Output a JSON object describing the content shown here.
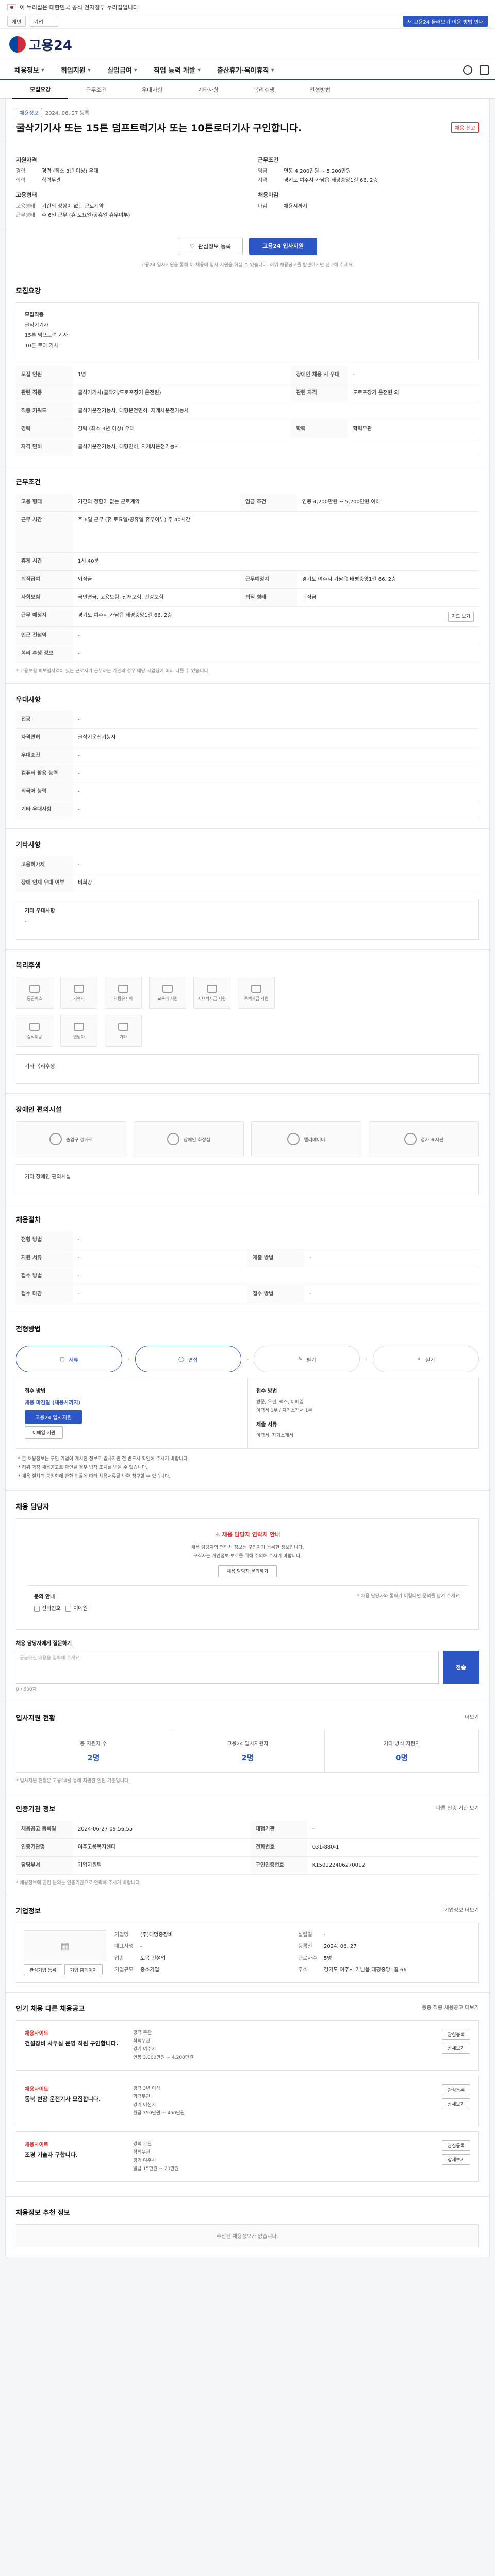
{
  "gov_bar": {
    "text": "이 누리집은 대한민국 공식 전자정부 누리집입니다."
  },
  "topline": {
    "tag_label": "개인",
    "select_value": "기업",
    "right_pill": "새 고용24 둘러보기 이용 방법 안내"
  },
  "header": {
    "logo_text": "고용24"
  },
  "nav": {
    "items": [
      {
        "label": "채용정보"
      },
      {
        "label": "취업지원"
      },
      {
        "label": "실업급여"
      },
      {
        "label": "직업 능력 개발"
      },
      {
        "label": "출산휴가·육아휴직"
      }
    ]
  },
  "subnav": {
    "tabs": [
      {
        "label": "모집요강"
      },
      {
        "label": "근무조건"
      },
      {
        "label": "우대사항"
      },
      {
        "label": "기타사항"
      },
      {
        "label": "복리후생"
      },
      {
        "label": "전형방법"
      }
    ]
  },
  "job": {
    "badge1": "채용정보",
    "badge_meta": "2024. 06. 27 등록",
    "title": "굴삭기기사 또는 15톤 덤프트럭기사 또는 10톤로더기사 구인합니다.",
    "report_label": "채용 신고",
    "summary_left_header": "지원자격",
    "summary_left": [
      {
        "k": "경력",
        "v": "경력 (최소 3년 이상) 우대"
      },
      {
        "k": "학력",
        "v": "학력무관"
      }
    ],
    "summary_right_header": "근무조건",
    "summary_right": [
      {
        "k": "임금",
        "v": "연봉 4,200만원 ~ 5,200만원"
      },
      {
        "k": "지역",
        "v": "경기도 여주시 가남읍 태평중앙1길 66, 2층"
      }
    ],
    "summary_left2_header": "고용형태",
    "summary_left2": [
      {
        "k": "고용형태",
        "v": "기간의 정함이 없는 근로계약"
      },
      {
        "k": "근무형태",
        "v": "주 6일 근무 (휴 토요일/공휴일 휴무여부)"
      }
    ],
    "summary_right2_header": "채용마감",
    "summary_right2": [
      {
        "k": "마감",
        "v": "채용시까지"
      }
    ],
    "btn_save": "관심정보 등록",
    "btn_apply": "고용24 입사지원",
    "note": "고용24 입사지원을 통해 이 채용에 입사 지원을 하실 수 있습니다. 허위 채용공고를 발견하시면 신고해 주세요."
  },
  "sec_recruit": {
    "title": "모집요강",
    "box_lines": [
      "모집직종",
      "굴삭기기사",
      "15톤 덤프트럭 기사",
      "10톤 로더 기사"
    ],
    "rows": [
      {
        "k": "모집 인원",
        "v": "1명",
        "k2": "장애인 채용 시 우대",
        "v2": "-"
      },
      {
        "k": "관련 직종",
        "v": "굴삭기기사(굴착기/도로포장기 운전원)",
        "k2": "관련 자격",
        "v2": "도로포장기 운전원 외"
      },
      {
        "k": "직종 키워드",
        "v": "굴삭기운전기능사, 대형운전면허, 지게차운전기능사"
      },
      {
        "k": "경력",
        "v": "경력 (최소 3년 이상) 우대",
        "k2": "학력",
        "v2": "학력무관"
      },
      {
        "k": "자격 면허",
        "v": "굴삭기운전기능사, 대형면허, 지게차운전기능사"
      }
    ]
  },
  "sec_work": {
    "title": "근무조건",
    "rows": [
      {
        "k": "고용 형태",
        "v": "기간의 정함이 없는 근로계약",
        "k2": "임금 조건",
        "v2": "연봉 4,200만원 ~ 5,200만원 이하"
      },
      {
        "k": "근무 시간",
        "v": "주 6일 근무 (휴 토요일/공휴일 휴무여부)  주 40시간"
      },
      {
        "k": "휴게 시간",
        "v": "1시 40분"
      },
      {
        "k": "퇴직급여",
        "v": "퇴직금",
        "k2": "근무예정지",
        "v2": "경기도 여주시 가남읍 태평중앙1길 66, 2층"
      },
      {
        "k": "사회보험",
        "v": "국민연금, 고용보험, 산재보험, 건강보험",
        "k2": "퇴직 형태",
        "v2": "퇴직금"
      },
      {
        "k": "근무 예정지",
        "v": "경기도 여주시 가남읍 태평중앙1길 66, 2층"
      },
      {
        "k": "인근 전철역",
        "v": "-"
      },
      {
        "k": "복리 후생 정보",
        "v": "-"
      }
    ],
    "map_btn": "지도 보기",
    "hint": "* 고용보험 피보험자격이 있는 근로자가 근무하는 기관의 경우 해당 사업장에 따라 다를 수 있습니다."
  },
  "sec_pref": {
    "title": "우대사항",
    "rows": [
      {
        "k": "전공",
        "v": "-"
      },
      {
        "k": "자격면허",
        "v": "굴삭기운전기능사"
      },
      {
        "k": "우대조건",
        "v": "-"
      },
      {
        "k": "컴퓨터 활용 능력",
        "v": "-"
      },
      {
        "k": "외국어 능력",
        "v": "-"
      },
      {
        "k": "기타 우대사항",
        "v": "-"
      }
    ]
  },
  "sec_etc": {
    "title": "기타사항",
    "rows": [
      {
        "k": "고용허가제",
        "v": "-"
      },
      {
        "k": "장애 인재 우대 여부",
        "v": "비희망"
      }
    ],
    "box_title": "기타 우대사항",
    "box_value": "-"
  },
  "sec_welfare": {
    "title": "복리후생",
    "tiles": [
      {
        "label": "통근버스"
      },
      {
        "label": "기숙사"
      },
      {
        "label": "차량유지비"
      },
      {
        "label": "교육비 지원"
      },
      {
        "label": "자녀학자금 지원"
      },
      {
        "label": "주택자금 지원"
      },
      {
        "label": "중식제공"
      },
      {
        "label": "연월차"
      },
      {
        "label": "기타"
      }
    ],
    "box_title": "기타 복리후생"
  },
  "sec_disabled": {
    "title": "장애인 편의시설",
    "tiles": [
      {
        "label": "출입구 경사로"
      },
      {
        "label": "장애인 화장실"
      },
      {
        "label": "엘리베이터"
      },
      {
        "label": "점자 표지판"
      }
    ],
    "box_title": "기타 장애인 편의시설"
  },
  "sec_hire": {
    "title": "채용절차",
    "rows": [
      {
        "k": "전형 방법",
        "v": "-"
      },
      {
        "k": "지원 서류",
        "v": "-",
        "k2": "제출 방법",
        "v2": "-"
      },
      {
        "k": "접수 방법",
        "v": "-"
      },
      {
        "k": "접수 마감",
        "v": "-",
        "k2": "접수 방법",
        "v2": "-"
      }
    ]
  },
  "sec_method": {
    "title": "전형방법",
    "steps": [
      {
        "label": "서류"
      },
      {
        "label": "면접"
      },
      {
        "label": "필기"
      },
      {
        "label": "실기"
      }
    ],
    "apply_label": "접수 방법",
    "apply_value": "채용 마감일 (채용시까지)",
    "apply_btn": "고용24 입사지원",
    "apply_btn2": "이메일 지원",
    "doc_label": "접수 방법",
    "doc_value": "방문, 우편, 팩스, 이메일",
    "doc_small": "이력서 1부 / 자기소개서 1부",
    "mail_label": "제출 서류",
    "mail_value": "이력서, 자기소개서",
    "bullets": [
      "* 본 채용정보는 구인 기업이 게시한 정보로 입사지원 전 반드시 확인해 주시기 바랍니다.",
      "* 허위·과장 채용공고로 확인될 경우 법적 조치를 받을 수 있습니다.",
      "* 채용 절차의 공정화에 관한 법률에 따라 채용서류를 반환 청구할 수 있습니다."
    ]
  },
  "sec_contact": {
    "title": "채용 담당자",
    "warn_title": "채용 담당자 연락처 안내",
    "warn_lines": [
      "채용 담당자의 연락처 정보는 구인자가 등록한 정보입니다.",
      "구직자는 개인정보 보호를 위해 주의해 주시기 바랍니다."
    ],
    "warn_btn": "채용 담당자 문의하기",
    "inq_title": "문의 안내",
    "inq_left_label": "전화번호",
    "inq_right_label": "이메일",
    "inq_note": "* 채용 담당자와 통화가 어렵다면 문의를 남겨 주세요.",
    "textarea_title": "채용 담당자에게 질문하기",
    "textarea_placeholder": "궁금하신 내용을 입력해 주세요.",
    "send": "전송",
    "count": "0 / 500자"
  },
  "sec_stats": {
    "title": "입사지원 현황",
    "more": "더보기",
    "cells": [
      {
        "t": "총 지원자 수",
        "n": "2명"
      },
      {
        "t": "고용24 입사지원자",
        "n": "2명"
      },
      {
        "t": "기타 방식 지원자",
        "n": "0명"
      }
    ],
    "hint": "* 입사지원 현황은 고용24를 통해 지원한 인원 기준입니다."
  },
  "sec_agency": {
    "title": "인증기관 정보",
    "btn": "다른 인증 기관 보기",
    "rows": [
      {
        "k": "채용공고 등록일",
        "v": "2024-06-27 09:56:55",
        "k2": "대행기관",
        "v2": "-"
      },
      {
        "k": "인증기관명",
        "v": "여주고용복지센터",
        "k2": "전화번호",
        "v2": "031-880-1"
      },
      {
        "k": "담당부서",
        "v": "기업지원팀",
        "k2": "구인인증번호",
        "v2": "K150122406270012"
      }
    ],
    "hint": "* 채용정보에 관한 문의는 인증기관으로 연락해 주시기 바랍니다."
  },
  "sec_company": {
    "title": "기업정보",
    "more": "기업정보 더보기",
    "name_label": "기업명",
    "name": "(주)대명중장비",
    "ceo_label": "대표자명",
    "ceo": "-",
    "since_label": "설립일",
    "since": "-",
    "addr_label": "주소",
    "addr": "경기도 여주시 가남읍 태평중앙1길 66",
    "biz_label": "업종",
    "biz": "토목 건설업",
    "size_label": "기업규모",
    "size": "중소기업",
    "emp_label": "근로자수",
    "emp": "5명",
    "reg_label": "등록일",
    "reg": "2024. 06. 27",
    "btn_left": "관심기업 등록",
    "btn_right": "기업 홈페이지"
  },
  "sec_related": {
    "title": "인기 채용 다른 채용공고",
    "more": "동종 직종 채용공고 더보기",
    "cards": [
      {
        "co": "채용사이트",
        "title": "건설장비 사무실 운영 직원 구인합니다.",
        "info": [
          "경력 무관",
          "학력무관",
          "경기 여주시",
          "연봉 3,000만원 ~ 4,200만원"
        ],
        "b1": "관심등록",
        "b2": "상세보기"
      },
      {
        "co": "채용사이트",
        "title": "동북 현장 운전기사 모집합니다.",
        "info": [
          "경력 3년 이상",
          "학력무관",
          "경기 이천시",
          "월급 350만원 ~ 450만원"
        ],
        "b1": "관심등록",
        "b2": "상세보기"
      },
      {
        "co": "채용사이트",
        "title": "조경 기술자 구합니다.",
        "info": [
          "경력 무관",
          "학력무관",
          "경기 여주시",
          "일급 15만원 ~ 20만원"
        ],
        "b1": "관심등록",
        "b2": "상세보기"
      }
    ]
  },
  "sec_recommend": {
    "title": "채용정보 추천 정보",
    "empty": "추천된 채용정보가 없습니다."
  }
}
